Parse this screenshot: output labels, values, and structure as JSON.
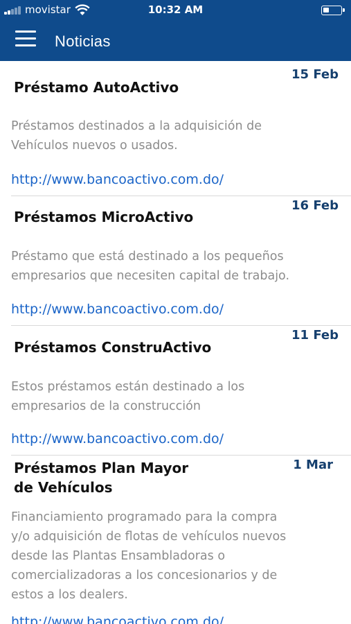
{
  "status_bar": {
    "carrier": "movistar",
    "time": "10:32 AM"
  },
  "header": {
    "title": "Noticias",
    "menu_icon": "hamburger-menu-icon"
  },
  "colors": {
    "header_bg": "#0f4b8c",
    "date": "#153f6e",
    "link": "#1a64c8",
    "description": "#8c8c8c"
  },
  "news": [
    {
      "date": "15 Feb",
      "title": "Préstamo AutoActivo",
      "description_lines": [
        "Préstamos destinados a la adquisición de",
        "Vehículos nuevos o usados."
      ],
      "link": "http://www.bancoactivo.com.do/"
    },
    {
      "date": "16 Feb",
      "title": "Préstamos MicroActivo",
      "description_lines": [
        "Préstamo que está destinado a los pequeños",
        "empresarios que necesiten capital de trabajo."
      ],
      "link": "http://www.bancoactivo.com.do/"
    },
    {
      "date": "11 Feb",
      "title": "Préstamos ConstruActivo",
      "description_lines": [
        "Estos préstamos están destinado a los",
        "empresarios de la construcción"
      ],
      "link": "http://www.bancoactivo.com.do/"
    },
    {
      "date": "1 Mar",
      "title_lines": [
        "Préstamos Plan Mayor",
        "de Vehículos"
      ],
      "description_lines": [
        "Financiamiento programado para la compra",
        "y/o adquisición de flotas de vehículos nuevos",
        "desde las Plantas Ensambladoras o",
        "comercializadoras a los concesionarios y de",
        "estos a los dealers."
      ],
      "link": "http://www.bancoactivo.com.do/"
    }
  ]
}
